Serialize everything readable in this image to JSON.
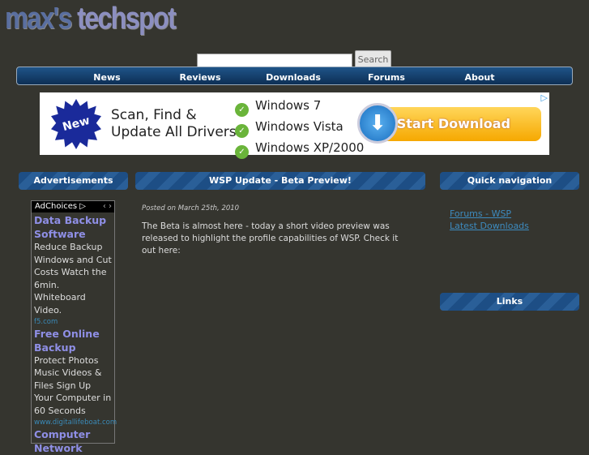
{
  "logo": {
    "text1": "max's",
    "text2": "techspot"
  },
  "search": {
    "value": "",
    "button": "Search"
  },
  "nav": [
    "News",
    "Reviews",
    "Downloads",
    "Forums",
    "About"
  ],
  "banner": {
    "badge": "New",
    "headline1": "Scan, Find &",
    "headline2": "Update All Drivers",
    "items": [
      "Windows 7",
      "Windows Vista",
      "Windows XP/2000"
    ],
    "cta": "Start Download"
  },
  "left": {
    "header": "Advertisements",
    "adchoices": "AdChoices",
    "ads": [
      {
        "title": "Data Backup",
        "title2": "Software",
        "body": "Reduce Backup Windows and Cut Costs Watch the 6min. Whiteboard Video.",
        "url": "f5.com"
      },
      {
        "title": "Free Online",
        "title2": "Backup",
        "body": "Protect Photos Music Videos & Files Sign Up Your Computer in 60 Seconds",
        "url": "www.digitallifeboat.com"
      },
      {
        "title": "Computer",
        "title2": "Network"
      }
    ]
  },
  "post": {
    "title": "WSP Update - Beta Preview!",
    "date": "Posted on March 25th, 2010",
    "body": "The Beta is almost here - today a short video preview was released to highlight the profile capabilities of WSP. Check it out here:"
  },
  "right": {
    "quicknav": "Quick navigation",
    "links": [
      "Forums - WSP",
      "Latest Downloads"
    ],
    "links_header": "Links"
  }
}
